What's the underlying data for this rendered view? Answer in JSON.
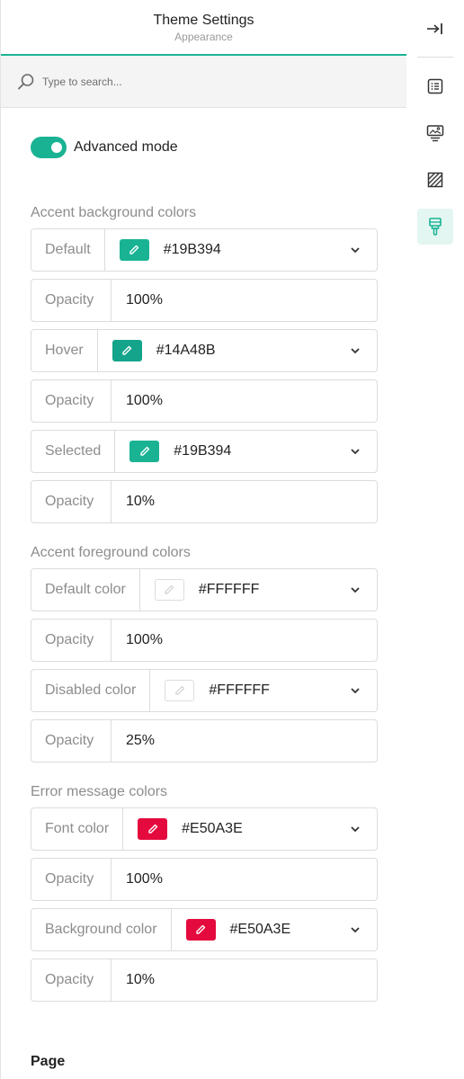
{
  "header": {
    "title": "Theme Settings",
    "subtitle": "Appearance"
  },
  "search": {
    "placeholder": "Type to search..."
  },
  "advanced_mode": {
    "label": "Advanced mode",
    "enabled": true
  },
  "sections": {
    "accent_background": {
      "title": "Accent background colors",
      "default": {
        "label": "Default",
        "color": "#19B394"
      },
      "default_opacity": {
        "label": "Opacity",
        "value": "100%"
      },
      "hover": {
        "label": "Hover",
        "color": "#14A48B"
      },
      "hover_opacity": {
        "label": "Opacity",
        "value": "100%"
      },
      "selected": {
        "label": "Selected",
        "color": "#19B394"
      },
      "selected_opacity": {
        "label": "Opacity",
        "value": "10%"
      }
    },
    "accent_foreground": {
      "title": "Accent foreground colors",
      "default": {
        "label": "Default color",
        "color": "#FFFFFF"
      },
      "default_opacity": {
        "label": "Opacity",
        "value": "100%"
      },
      "disabled": {
        "label": "Disabled color",
        "color": "#FFFFFF"
      },
      "disabled_opacity": {
        "label": "Opacity",
        "value": "25%"
      }
    },
    "error_message": {
      "title": "Error message colors",
      "font": {
        "label": "Font color",
        "color": "#E50A3E"
      },
      "font_opacity": {
        "label": "Opacity",
        "value": "100%"
      },
      "background": {
        "label": "Background color",
        "color": "#E50A3E"
      },
      "background_opacity": {
        "label": "Opacity",
        "value": "10%"
      }
    }
  },
  "page_heading": "Page",
  "sidebar": {
    "items": [
      {
        "icon": "collapse-panel-icon"
      },
      {
        "icon": "list-icon"
      },
      {
        "icon": "presentation-icon"
      },
      {
        "icon": "hatched-square-icon"
      },
      {
        "icon": "paint-brush-icon",
        "active": true
      }
    ]
  },
  "colors": {
    "accent": "#19B394",
    "accent_hover": "#14A48B",
    "error": "#E50A3E",
    "active_bg": "#E3F6F1"
  }
}
